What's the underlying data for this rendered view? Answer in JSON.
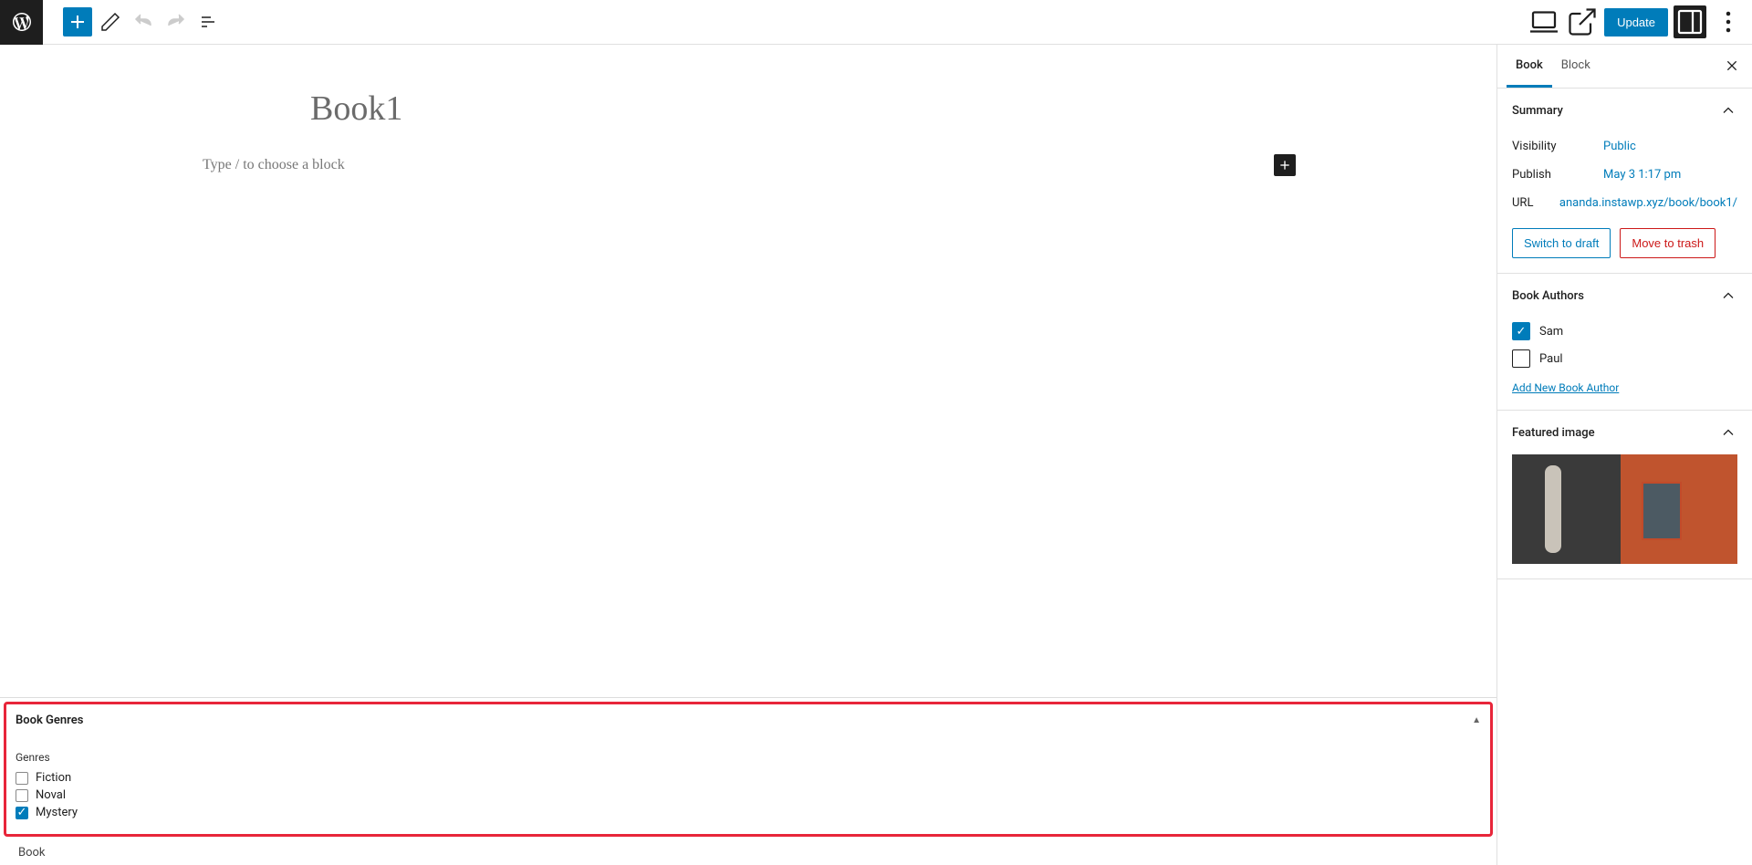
{
  "toolbar": {
    "update_label": "Update"
  },
  "post": {
    "title": "Book1",
    "placeholder": "Type / to choose a block"
  },
  "sidebar": {
    "tabs": {
      "book": "Book",
      "block": "Block"
    },
    "summary": {
      "title": "Summary",
      "rows": {
        "visibility_label": "Visibility",
        "visibility_value": "Public",
        "publish_label": "Publish",
        "publish_value": "May 3 1:17 pm",
        "url_label": "URL",
        "url_value": "ananda.instawp.xyz/book/book1/"
      },
      "switch_draft": "Switch to draft",
      "move_trash": "Move to trash"
    },
    "authors": {
      "title": "Book Authors",
      "items": [
        {
          "name": "Sam",
          "checked": true
        },
        {
          "name": "Paul",
          "checked": false
        }
      ],
      "add_link": "Add New Book Author"
    },
    "featured": {
      "title": "Featured image"
    }
  },
  "metabox": {
    "title": "Book Genres",
    "subtitle": "Genres",
    "items": [
      {
        "name": "Fiction",
        "checked": false
      },
      {
        "name": "Noval",
        "checked": false
      },
      {
        "name": "Mystery",
        "checked": true
      }
    ]
  },
  "footer": {
    "label": "Book"
  }
}
